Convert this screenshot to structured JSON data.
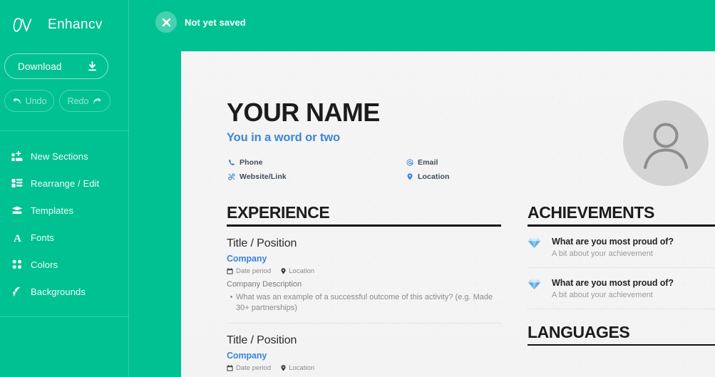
{
  "sidebar": {
    "brand": {
      "name": "Enhancv",
      "logo_icon": "enhancv-cv-logo-icon"
    },
    "download_button": {
      "label": "Download",
      "icon": "download-icon"
    },
    "undo_button": {
      "label": "Undo",
      "icon": "undo-arrow-icon"
    },
    "redo_button": {
      "label": "Redo",
      "icon": "redo-arrow-icon"
    },
    "items": [
      {
        "label": "New Sections",
        "icon": "add-section-icon"
      },
      {
        "label": "Rearrange / Edit",
        "icon": "layout-blocks-icon"
      },
      {
        "label": "Templates",
        "icon": "templates-stack-icon"
      },
      {
        "label": "Fonts",
        "icon": "font-letter-a-icon"
      },
      {
        "label": "Colors",
        "icon": "color-dots-icon"
      },
      {
        "label": "Backgrounds",
        "icon": "paint-roller-icon"
      }
    ]
  },
  "topbar": {
    "save_status": {
      "label": "Not yet saved",
      "icon": "close-x-circle-icon"
    }
  },
  "resume": {
    "name": "YOUR NAME",
    "tagline": "You in a word or two",
    "avatar_icon": "person-placeholder-icon",
    "contacts": [
      {
        "label": "Phone",
        "icon": "phone-icon"
      },
      {
        "label": "Email",
        "icon": "at-email-icon"
      },
      {
        "label": "Website/Link",
        "icon": "link-chain-icon"
      },
      {
        "label": "Location",
        "icon": "map-pin-icon"
      }
    ],
    "experience": {
      "heading": "EXPERIENCE",
      "entries": [
        {
          "title": "Title / Position",
          "company": "Company",
          "date_icon": "calendar-icon",
          "date": "Date period",
          "location_icon": "map-pin-icon",
          "location": "Location",
          "description": "Company Description",
          "bullets": [
            "What was an example of a successful outcome of this activity? (e.g. Made 30+ partnerships)"
          ]
        },
        {
          "title": "Title / Position",
          "company": "Company",
          "date_icon": "calendar-icon",
          "date": "Date period",
          "location_icon": "map-pin-icon",
          "location": "Location"
        }
      ]
    },
    "achievements": {
      "heading": "ACHIEVEMENTS",
      "items": [
        {
          "icon": "diamond-icon",
          "title": "What are you most proud of?",
          "subtitle": "A bit about your achievement"
        },
        {
          "icon": "diamond-icon",
          "title": "What are you most proud of?",
          "subtitle": "A bit about your achievement"
        }
      ]
    },
    "languages": {
      "heading": "LANGUAGES"
    }
  },
  "colors": {
    "brand_green": "#00c191",
    "accent_blue": "#3d85d8",
    "heading_dark": "#1c1c1c",
    "paper": "#f4f4f4",
    "muted_text": "#8a8a8a"
  }
}
